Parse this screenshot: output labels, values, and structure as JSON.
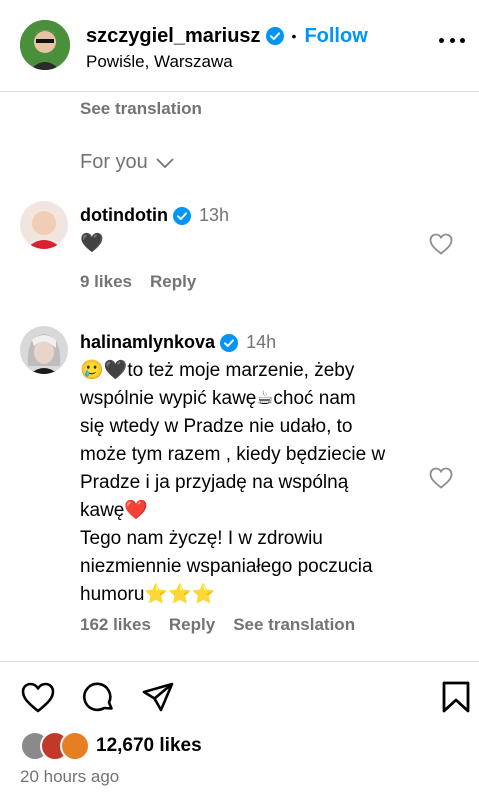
{
  "header": {
    "username": "szczygiel_mariusz",
    "separator": "•",
    "follow_label": "Follow",
    "location": "Powiśle, Warszawa"
  },
  "top_see_translation": "See translation",
  "for_you_label": "For you",
  "comments": [
    {
      "username": "dotindotin",
      "time": "13h",
      "text": "🖤",
      "likes": "9 likes",
      "reply": "Reply"
    },
    {
      "username": "halinamlynkova",
      "time": "14h",
      "text_lines": [
        "🥲🖤to też moje marzenie, żeby",
        "wspólnie wypić kawę☕choć nam",
        "się wtedy w Pradze nie udało, to",
        "może tym razem , kiedy będziecie w",
        "Pradze i ja przyjadę na wspólną",
        "kawę❤️",
        "Tego nam życzę! I w zdrowiu",
        "niezmiennie wspaniałego poczucia",
        "humoru⭐⭐⭐"
      ],
      "likes": "162 likes",
      "reply": "Reply",
      "see_translation": "See translation"
    }
  ],
  "post": {
    "likes": "12,670 likes",
    "time_ago": "20 hours ago"
  },
  "icons": {
    "verified": "verified-badge-icon",
    "more": "more-options-icon",
    "chevron": "chevron-down-icon",
    "like": "heart-icon",
    "comment": "comment-icon",
    "share": "share-icon",
    "save": "bookmark-icon"
  },
  "colors": {
    "accent": "#0095f6",
    "secondary_text": "#737373",
    "divider": "#dbdbdb"
  }
}
